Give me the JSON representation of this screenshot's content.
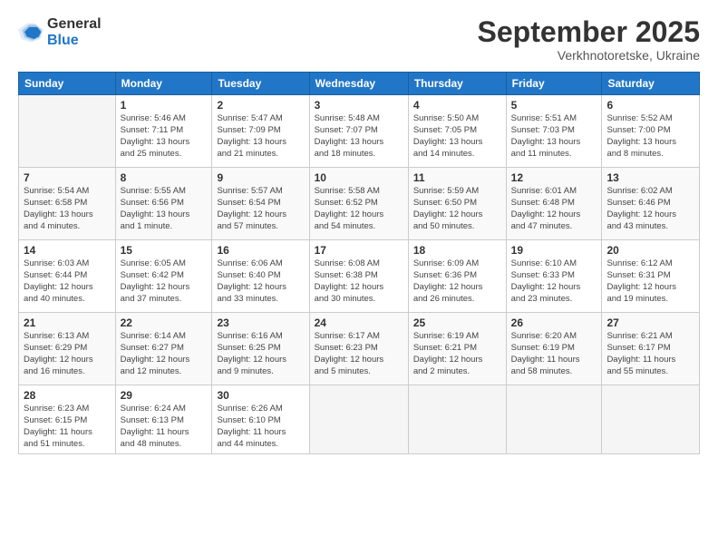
{
  "logo": {
    "general": "General",
    "blue": "Blue"
  },
  "title": "September 2025",
  "subtitle": "Verkhnotoretske, Ukraine",
  "weekdays": [
    "Sunday",
    "Monday",
    "Tuesday",
    "Wednesday",
    "Thursday",
    "Friday",
    "Saturday"
  ],
  "weeks": [
    [
      {
        "day": "",
        "info": ""
      },
      {
        "day": "1",
        "info": "Sunrise: 5:46 AM\nSunset: 7:11 PM\nDaylight: 13 hours\nand 25 minutes."
      },
      {
        "day": "2",
        "info": "Sunrise: 5:47 AM\nSunset: 7:09 PM\nDaylight: 13 hours\nand 21 minutes."
      },
      {
        "day": "3",
        "info": "Sunrise: 5:48 AM\nSunset: 7:07 PM\nDaylight: 13 hours\nand 18 minutes."
      },
      {
        "day": "4",
        "info": "Sunrise: 5:50 AM\nSunset: 7:05 PM\nDaylight: 13 hours\nand 14 minutes."
      },
      {
        "day": "5",
        "info": "Sunrise: 5:51 AM\nSunset: 7:03 PM\nDaylight: 13 hours\nand 11 minutes."
      },
      {
        "day": "6",
        "info": "Sunrise: 5:52 AM\nSunset: 7:00 PM\nDaylight: 13 hours\nand 8 minutes."
      }
    ],
    [
      {
        "day": "7",
        "info": "Sunrise: 5:54 AM\nSunset: 6:58 PM\nDaylight: 13 hours\nand 4 minutes."
      },
      {
        "day": "8",
        "info": "Sunrise: 5:55 AM\nSunset: 6:56 PM\nDaylight: 13 hours\nand 1 minute."
      },
      {
        "day": "9",
        "info": "Sunrise: 5:57 AM\nSunset: 6:54 PM\nDaylight: 12 hours\nand 57 minutes."
      },
      {
        "day": "10",
        "info": "Sunrise: 5:58 AM\nSunset: 6:52 PM\nDaylight: 12 hours\nand 54 minutes."
      },
      {
        "day": "11",
        "info": "Sunrise: 5:59 AM\nSunset: 6:50 PM\nDaylight: 12 hours\nand 50 minutes."
      },
      {
        "day": "12",
        "info": "Sunrise: 6:01 AM\nSunset: 6:48 PM\nDaylight: 12 hours\nand 47 minutes."
      },
      {
        "day": "13",
        "info": "Sunrise: 6:02 AM\nSunset: 6:46 PM\nDaylight: 12 hours\nand 43 minutes."
      }
    ],
    [
      {
        "day": "14",
        "info": "Sunrise: 6:03 AM\nSunset: 6:44 PM\nDaylight: 12 hours\nand 40 minutes."
      },
      {
        "day": "15",
        "info": "Sunrise: 6:05 AM\nSunset: 6:42 PM\nDaylight: 12 hours\nand 37 minutes."
      },
      {
        "day": "16",
        "info": "Sunrise: 6:06 AM\nSunset: 6:40 PM\nDaylight: 12 hours\nand 33 minutes."
      },
      {
        "day": "17",
        "info": "Sunrise: 6:08 AM\nSunset: 6:38 PM\nDaylight: 12 hours\nand 30 minutes."
      },
      {
        "day": "18",
        "info": "Sunrise: 6:09 AM\nSunset: 6:36 PM\nDaylight: 12 hours\nand 26 minutes."
      },
      {
        "day": "19",
        "info": "Sunrise: 6:10 AM\nSunset: 6:33 PM\nDaylight: 12 hours\nand 23 minutes."
      },
      {
        "day": "20",
        "info": "Sunrise: 6:12 AM\nSunset: 6:31 PM\nDaylight: 12 hours\nand 19 minutes."
      }
    ],
    [
      {
        "day": "21",
        "info": "Sunrise: 6:13 AM\nSunset: 6:29 PM\nDaylight: 12 hours\nand 16 minutes."
      },
      {
        "day": "22",
        "info": "Sunrise: 6:14 AM\nSunset: 6:27 PM\nDaylight: 12 hours\nand 12 minutes."
      },
      {
        "day": "23",
        "info": "Sunrise: 6:16 AM\nSunset: 6:25 PM\nDaylight: 12 hours\nand 9 minutes."
      },
      {
        "day": "24",
        "info": "Sunrise: 6:17 AM\nSunset: 6:23 PM\nDaylight: 12 hours\nand 5 minutes."
      },
      {
        "day": "25",
        "info": "Sunrise: 6:19 AM\nSunset: 6:21 PM\nDaylight: 12 hours\nand 2 minutes."
      },
      {
        "day": "26",
        "info": "Sunrise: 6:20 AM\nSunset: 6:19 PM\nDaylight: 11 hours\nand 58 minutes."
      },
      {
        "day": "27",
        "info": "Sunrise: 6:21 AM\nSunset: 6:17 PM\nDaylight: 11 hours\nand 55 minutes."
      }
    ],
    [
      {
        "day": "28",
        "info": "Sunrise: 6:23 AM\nSunset: 6:15 PM\nDaylight: 11 hours\nand 51 minutes."
      },
      {
        "day": "29",
        "info": "Sunrise: 6:24 AM\nSunset: 6:13 PM\nDaylight: 11 hours\nand 48 minutes."
      },
      {
        "day": "30",
        "info": "Sunrise: 6:26 AM\nSunset: 6:10 PM\nDaylight: 11 hours\nand 44 minutes."
      },
      {
        "day": "",
        "info": ""
      },
      {
        "day": "",
        "info": ""
      },
      {
        "day": "",
        "info": ""
      },
      {
        "day": "",
        "info": ""
      }
    ]
  ]
}
